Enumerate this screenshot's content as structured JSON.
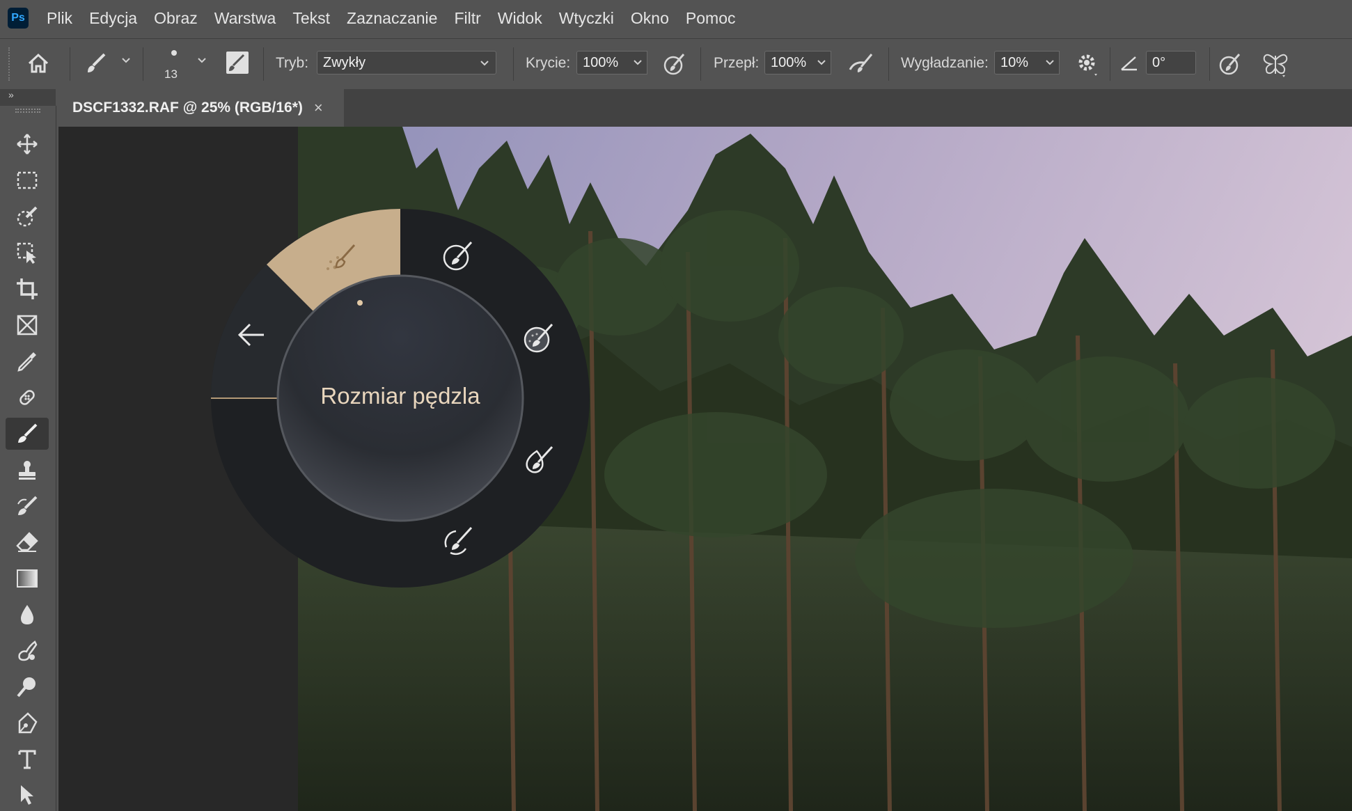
{
  "app": {
    "logo": "Ps"
  },
  "menu": [
    "Plik",
    "Edycja",
    "Obraz",
    "Warstwa",
    "Tekst",
    "Zaznaczanie",
    "Filtr",
    "Widok",
    "Wtyczki",
    "Okno",
    "Pomoc"
  ],
  "options": {
    "brush_size": "13",
    "mode_label": "Tryb:",
    "mode_value": "Zwykły",
    "opacity_label": "Krycie:",
    "opacity_value": "100%",
    "flow_label": "Przepł:",
    "flow_value": "100%",
    "smoothing_label": "Wygładzanie:",
    "smoothing_value": "10%",
    "angle_value": "0°"
  },
  "toolbar": {
    "collapse": "»"
  },
  "document": {
    "tab_title": "DSCF1332.RAF @ 25% (RGB/16*)",
    "close": "×"
  },
  "radial_menu": {
    "title": "Rozmiar pędzla",
    "accent": "#c7ae8c"
  },
  "colors": {
    "chrome": "#535353",
    "dark": "#424242",
    "canvas": "#282828",
    "menu_text": "#e6e6e6"
  },
  "icons": {
    "tools": [
      "move-icon",
      "marquee-icon",
      "quick-selection-icon",
      "object-selection-icon",
      "crop-icon",
      "frame-icon",
      "eyedropper-icon",
      "healing-brush-icon",
      "brush-icon",
      "clone-stamp-icon",
      "history-brush-icon",
      "eraser-icon",
      "gradient-icon",
      "blur-icon",
      "dodge-icon",
      "zoom-icon",
      "pen-icon",
      "type-icon",
      "path-selection-icon"
    ]
  }
}
